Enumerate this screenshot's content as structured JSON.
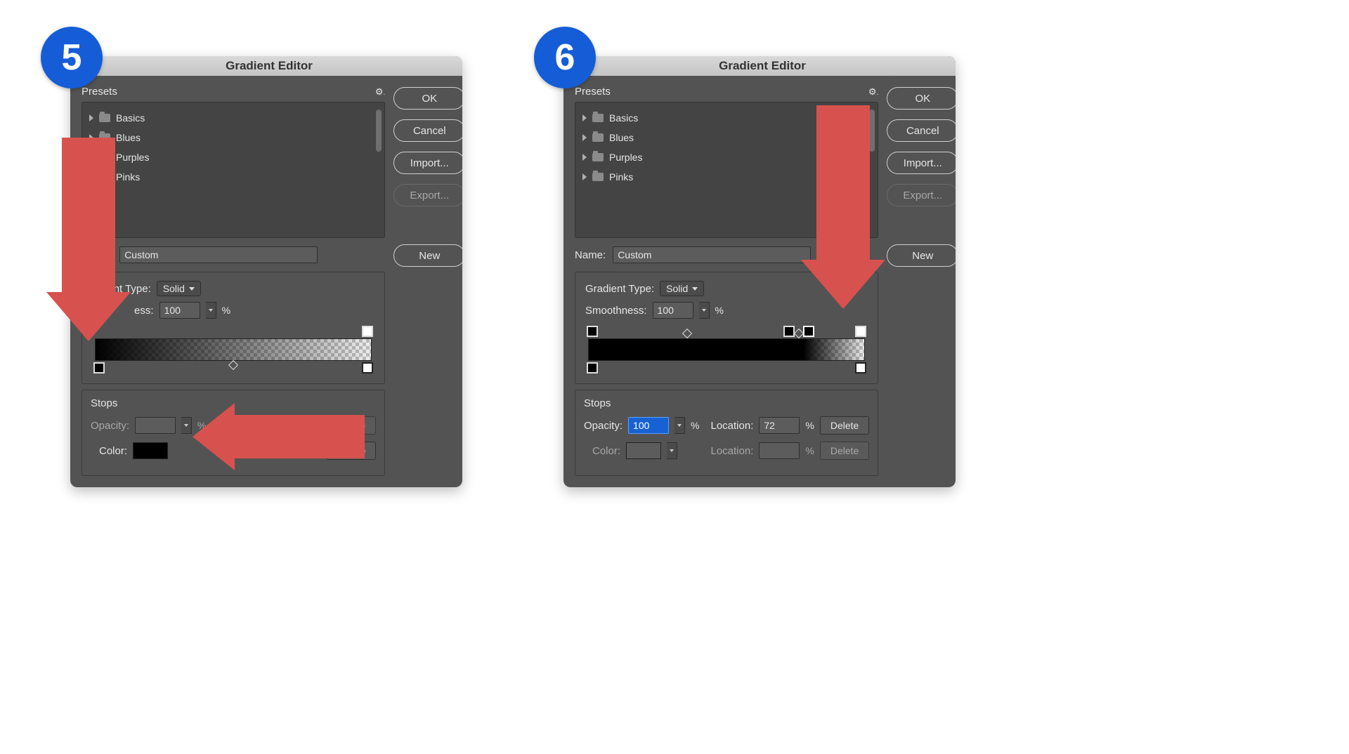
{
  "steps": [
    "5",
    "6"
  ],
  "dialogTitle": "Gradient Editor",
  "buttons": {
    "ok": "OK",
    "cancel": "Cancel",
    "import": "Import...",
    "export": "Export...",
    "new": "New",
    "delete": "Delete"
  },
  "presets": {
    "label": "Presets",
    "folders": [
      "Basics",
      "Blues",
      "Purples",
      "Pinks"
    ]
  },
  "fields": {
    "nameLabel": "Name:",
    "gradientTypeLabel": "Gradient Type:",
    "smoothnessLabel": "Smoothness:",
    "stopsLabel": "Stops",
    "opacityLabel": "Opacity:",
    "locationLabel": "Location:",
    "colorLabel": "Color:",
    "percent": "%"
  },
  "left": {
    "nameValue": "Custom",
    "gradientType": "Solid",
    "smoothness": "100",
    "opacityValue": "",
    "opacityLocation": "",
    "colorLocation": ""
  },
  "right": {
    "nameValue": "Custom",
    "gradientType": "Solid",
    "smoothness": "100",
    "opacityValue": "100",
    "opacityLocation": "72",
    "colorLocation": ""
  }
}
